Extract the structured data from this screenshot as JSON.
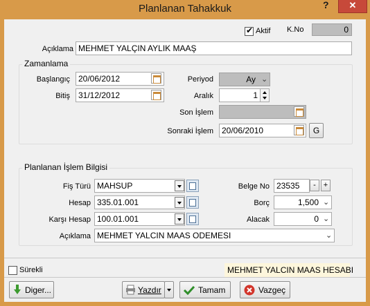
{
  "window": {
    "title": "Planlanan Tahakkuk",
    "help": "?",
    "close": "✕"
  },
  "top": {
    "aktif_label": "Aktif",
    "aktif_checked": true,
    "kno_label": "K.No",
    "kno_value": "0"
  },
  "aciklama": {
    "label": "Açıklama",
    "value": "MEHMET YALÇIN AYLIK MAAŞ"
  },
  "zamanlama": {
    "title": "Zamanlama",
    "baslangic_label": "Başlangıç",
    "baslangic_value": "20/06/2012",
    "bitis_label": "Bitiş",
    "bitis_value": "31/12/2012",
    "periyod_label": "Periyod",
    "periyod_value": "Ay",
    "aralik_label": "Aralık",
    "aralik_value": "1",
    "son_islem_label": "Son İşlem",
    "son_islem_value": "",
    "sonraki_islem_label": "Sonraki İşlem",
    "sonraki_islem_value": "20/06/2010",
    "g_button": "G"
  },
  "islem": {
    "title": "Planlanan İşlem Bilgisi",
    "fis_turu_label": "Fiş Türü",
    "fis_turu_value": "MAHSUP",
    "hesap_label": "Hesap",
    "hesap_value": "335.01.001",
    "karsi_hesap_label": "Karşı Hesap",
    "karsi_hesap_value": "100.01.001",
    "aciklama_label": "Açıklama",
    "aciklama_value": "MEHMET YALCIN MAAS ODEMESI",
    "belge_no_label": "Belge No",
    "belge_no_value": "23535",
    "minus": "-",
    "plus": "+",
    "borc_label": "Borç",
    "borc_value": "1,500",
    "alacak_label": "Alacak",
    "alacak_value": "0"
  },
  "status": {
    "surekli_label": "Sürekli",
    "surekli_checked": false,
    "hesabi_text": "MEHMET YALCIN MAAS HESABI"
  },
  "buttons": {
    "diger": "Diger...",
    "yazdir": "Yazdır",
    "tamam": "Tamam",
    "vazgec": "Vazgeç"
  },
  "colors": {
    "titlebar": "#d89a49",
    "close": "#c7493a",
    "status_bg": "#fdf6dc"
  }
}
